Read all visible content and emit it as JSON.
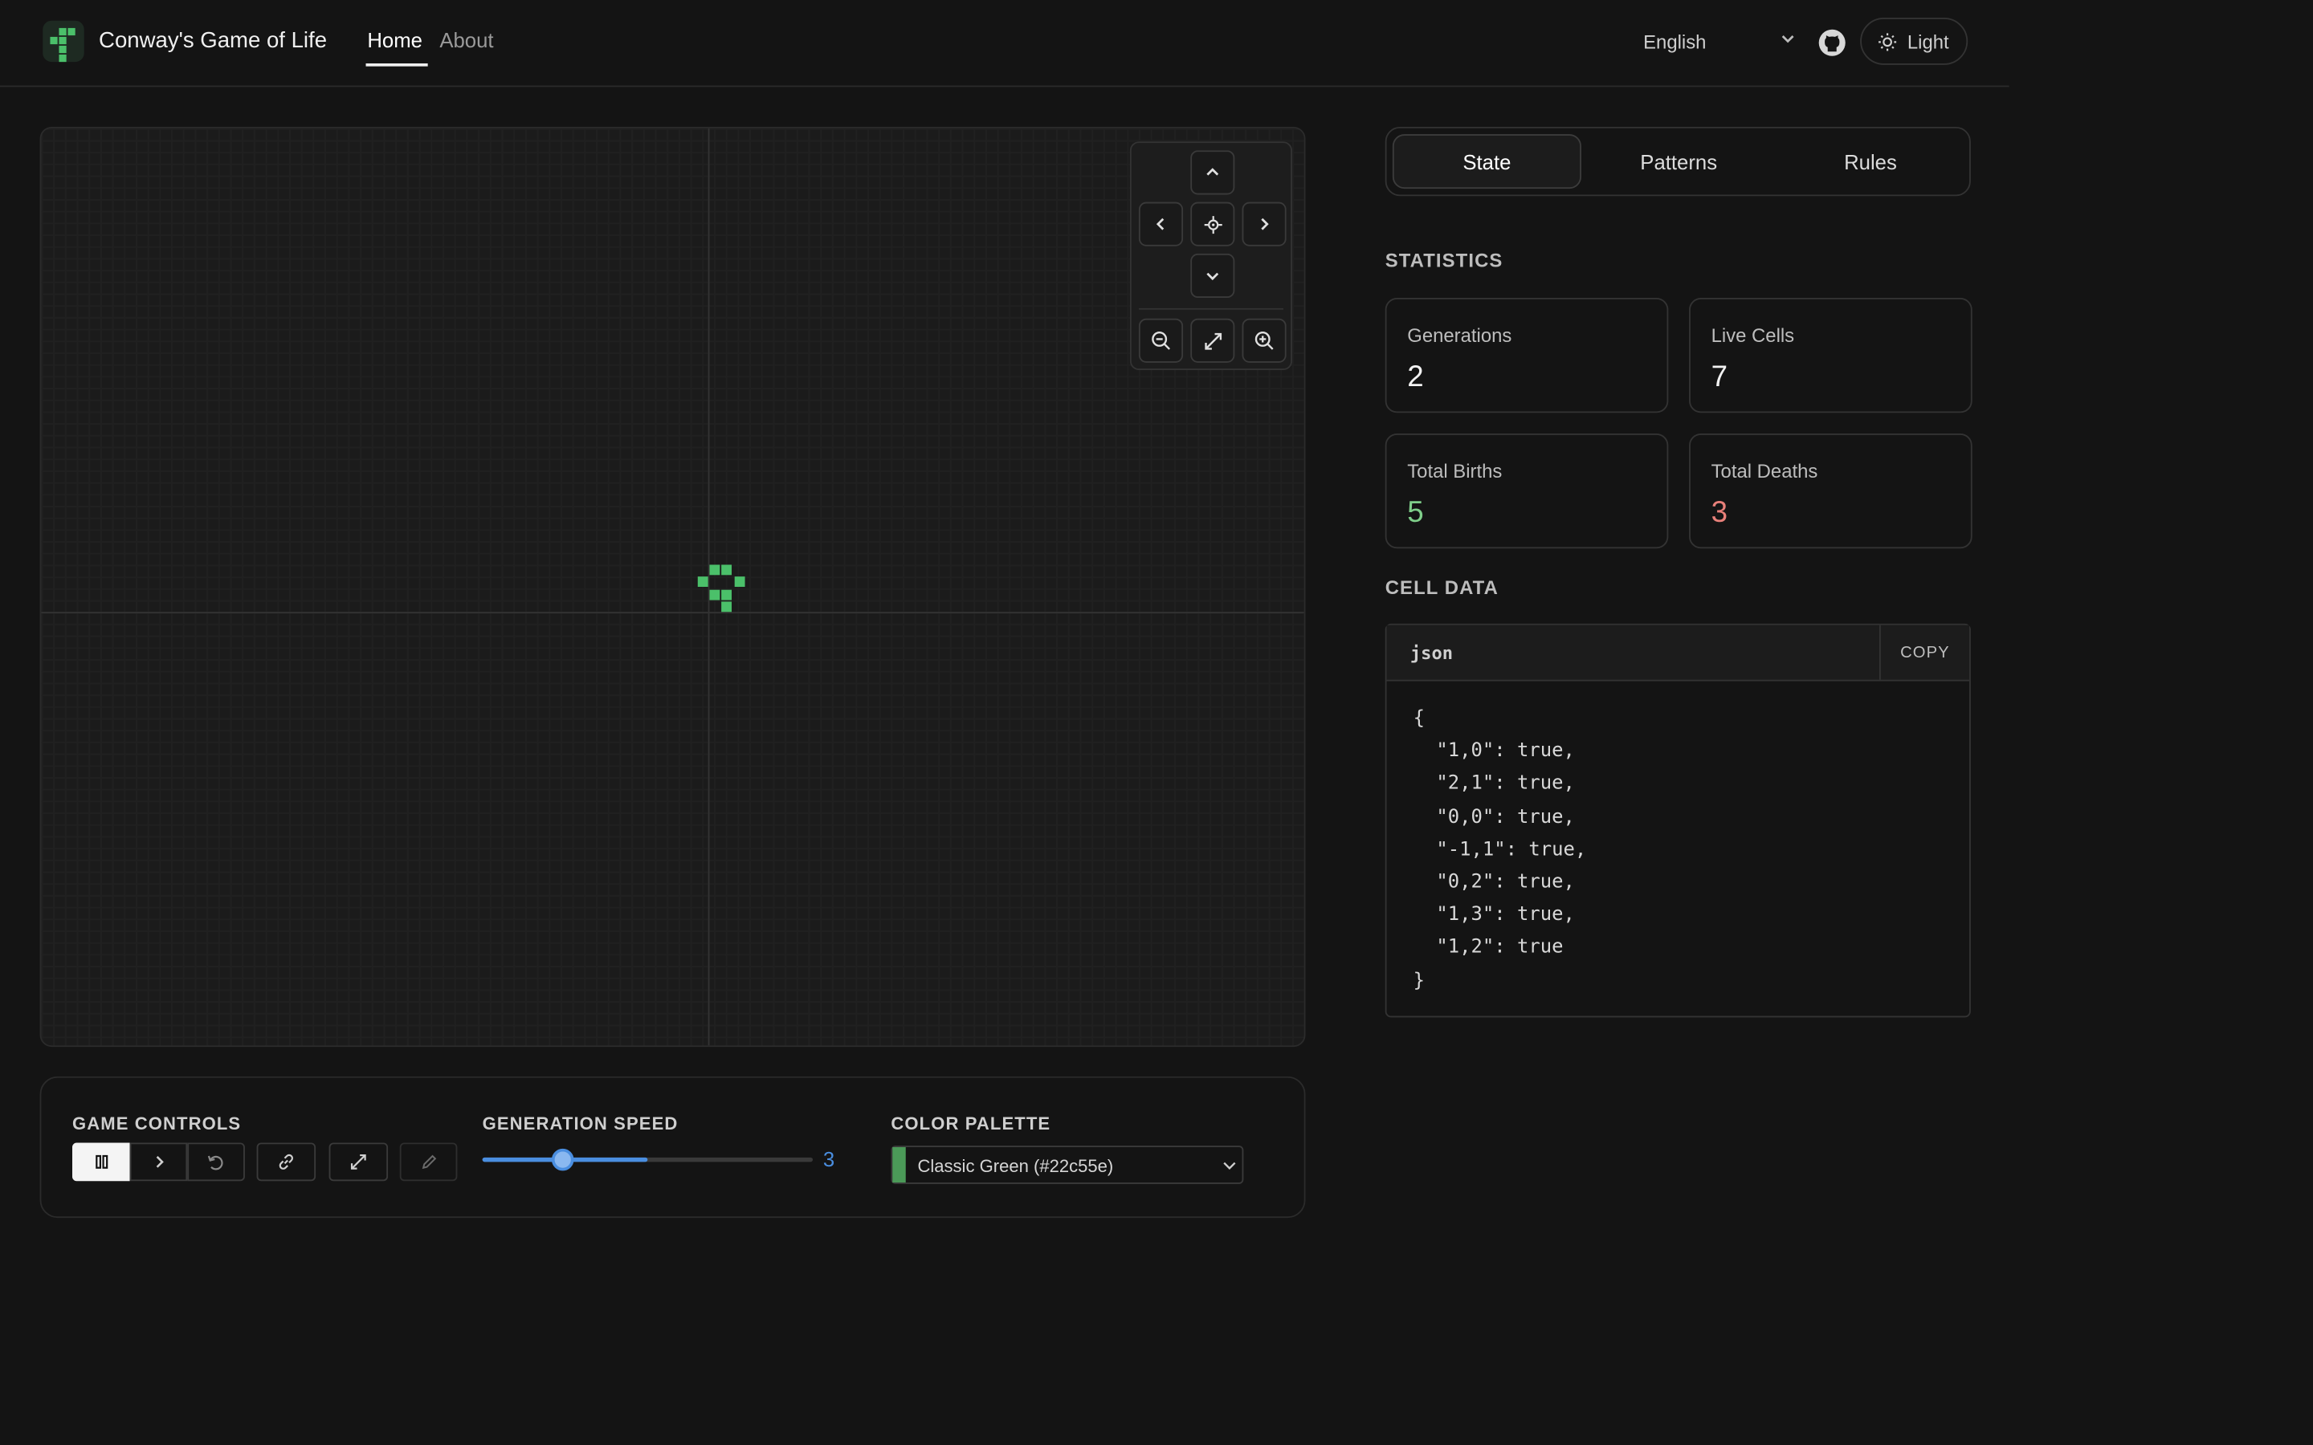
{
  "header": {
    "app_title": "Conway's Game of Life",
    "nav": [
      {
        "label": "Home",
        "active": true
      },
      {
        "label": "About",
        "active": false
      }
    ],
    "language": "English",
    "theme_label": "Light"
  },
  "grid": {
    "live_cells": [
      "1,0",
      "2,1",
      "0,0",
      "-1,1",
      "0,2",
      "1,3",
      "1,2"
    ],
    "cell_color": "#4bc06a"
  },
  "controls": {
    "game_controls_label": "GAME CONTROLS",
    "speed_label": "GENERATION SPEED",
    "speed_value": "3",
    "speed_fraction": 0.24,
    "palette_label": "COLOR PALETTE",
    "palette_selected": "Classic Green (#22c55e)",
    "palette_swatch": "#4b9a58"
  },
  "sidebar": {
    "tabs": [
      {
        "label": "State",
        "active": true
      },
      {
        "label": "Patterns",
        "active": false
      },
      {
        "label": "Rules",
        "active": false
      }
    ],
    "statistics_title": "STATISTICS",
    "stats": {
      "generations": {
        "label": "Generations",
        "value": "2",
        "color": "#f2f2f2"
      },
      "live_cells": {
        "label": "Live Cells",
        "value": "7",
        "color": "#f2f2f2"
      },
      "total_births": {
        "label": "Total Births",
        "value": "5",
        "color": "#7fcf8a"
      },
      "total_deaths": {
        "label": "Total Deaths",
        "value": "3",
        "color": "#e8807a"
      }
    },
    "cell_data_title": "CELL DATA",
    "code_lang": "json",
    "copy_label": "COPY",
    "code_text": "{\n  \"1,0\": true,\n  \"2,1\": true,\n  \"0,0\": true,\n  \"-1,1\": true,\n  \"0,2\": true,\n  \"1,3\": true,\n  \"1,2\": true\n}"
  }
}
